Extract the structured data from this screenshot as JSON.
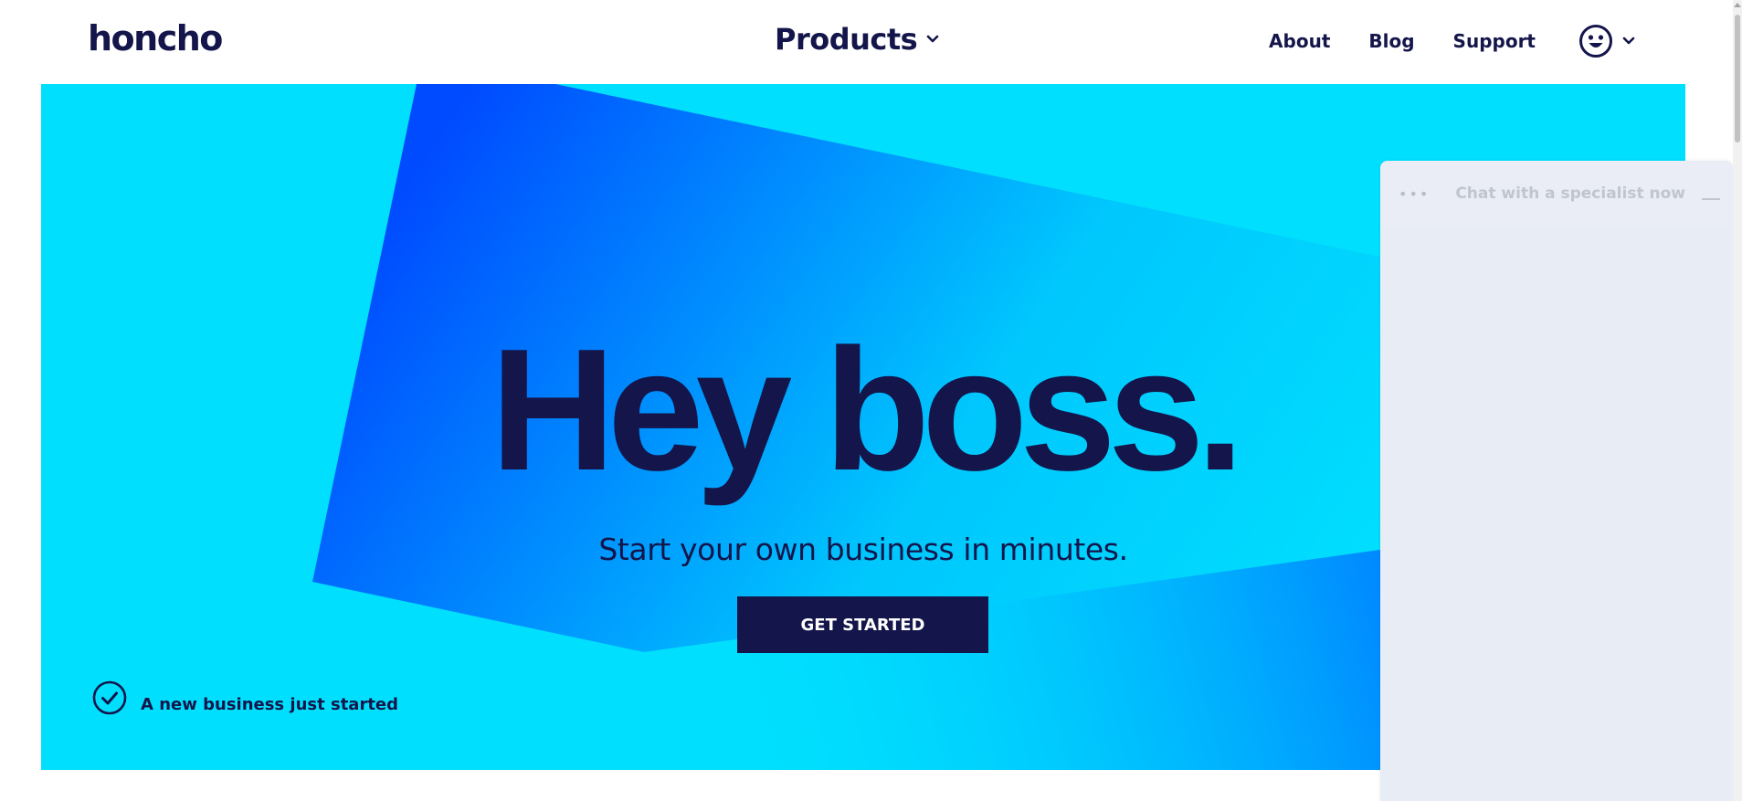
{
  "nav": {
    "logo": "honcho",
    "products_label": "Products",
    "links": [
      "About",
      "Blog",
      "Support"
    ],
    "account_icon": "smiley-face-icon"
  },
  "hero": {
    "headline": "Hey boss.",
    "subheadline": "Start your own business in minutes.",
    "cta_label": "GET STARTED",
    "notice_text": "A new business just started",
    "notice_icon": "check-circle-icon",
    "colors": {
      "background": "#00e0fe",
      "accent_blue": "#0052ff",
      "navy": "#14154a"
    }
  },
  "chat": {
    "title": "Chat with a specialist now",
    "menu_icon": "more-dots-icon",
    "minimize_icon": "minimize-icon"
  }
}
